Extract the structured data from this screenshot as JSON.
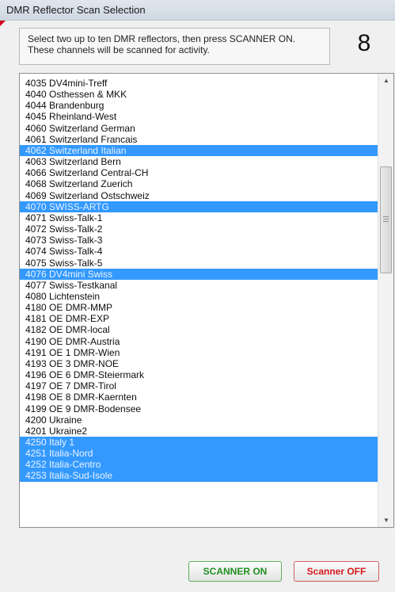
{
  "window": {
    "title": "DMR Reflector Scan Selection"
  },
  "instructions": {
    "line1": "Select two up to ten DMR reflectors, then press SCANNER ON.",
    "line2": "These channels will be scanned for activity."
  },
  "selected_count": "8",
  "reflectors": [
    {
      "label": "4035 DV4mini-Treff",
      "selected": false
    },
    {
      "label": "4040 Osthessen & MKK",
      "selected": false
    },
    {
      "label": "4044 Brandenburg",
      "selected": false
    },
    {
      "label": "4045 Rheinland-West",
      "selected": false
    },
    {
      "label": "4060 Switzerland German",
      "selected": false
    },
    {
      "label": "4061 Switzerland Francais",
      "selected": false
    },
    {
      "label": "4062 Switzerland Italian",
      "selected": true
    },
    {
      "label": "4063 Switzerland Bern",
      "selected": false
    },
    {
      "label": "4066 Switzerland Central-CH",
      "selected": false
    },
    {
      "label": "4068 Switzerland Zuerich",
      "selected": false
    },
    {
      "label": "4069 Switzerland Ostschweiz",
      "selected": false
    },
    {
      "label": "4070 SWISS-ARTG",
      "selected": true
    },
    {
      "label": "4071 Swiss-Talk-1",
      "selected": false
    },
    {
      "label": "4072 Swiss-Talk-2",
      "selected": false
    },
    {
      "label": "4073 Swiss-Talk-3",
      "selected": false
    },
    {
      "label": "4074 Swiss-Talk-4",
      "selected": false
    },
    {
      "label": "4075 Swiss-Talk-5",
      "selected": false
    },
    {
      "label": "4076 DV4mini Swiss",
      "selected": true
    },
    {
      "label": "4077 Swiss-Testkanal",
      "selected": false
    },
    {
      "label": "4080 Lichtenstein",
      "selected": false
    },
    {
      "label": "4180 OE DMR-MMP",
      "selected": false
    },
    {
      "label": "4181 OE DMR-EXP",
      "selected": false
    },
    {
      "label": "4182 OE DMR-local",
      "selected": false
    },
    {
      "label": "4190 OE DMR-Austria",
      "selected": false
    },
    {
      "label": "4191 OE 1 DMR-Wien",
      "selected": false
    },
    {
      "label": "4193 OE 3 DMR-NOE",
      "selected": false
    },
    {
      "label": "4196 OE 6 DMR-Steiermark",
      "selected": false
    },
    {
      "label": "4197 OE 7 DMR-Tirol",
      "selected": false
    },
    {
      "label": "4198 OE 8 DMR-Kaernten",
      "selected": false
    },
    {
      "label": "4199 OE 9 DMR-Bodensee",
      "selected": false
    },
    {
      "label": "4200 Ukraine",
      "selected": false
    },
    {
      "label": "4201 Ukraine2",
      "selected": false
    },
    {
      "label": "4250 Italy 1",
      "selected": true
    },
    {
      "label": "4251 Italia-Nord",
      "selected": true
    },
    {
      "label": "4252 Italia-Centro",
      "selected": true
    },
    {
      "label": "4253 Italia-Sud-Isole",
      "selected": true
    }
  ],
  "scrollbar": {
    "up_icon": "▲",
    "down_icon": "▼",
    "grip_icon": "≡"
  },
  "buttons": {
    "scanner_on": "SCANNER ON",
    "scanner_off": "Scanner OFF"
  },
  "colors": {
    "selection": "#3399ff",
    "scanner_on_text": "#1e8f1e",
    "scanner_off_text": "#d4191e"
  }
}
